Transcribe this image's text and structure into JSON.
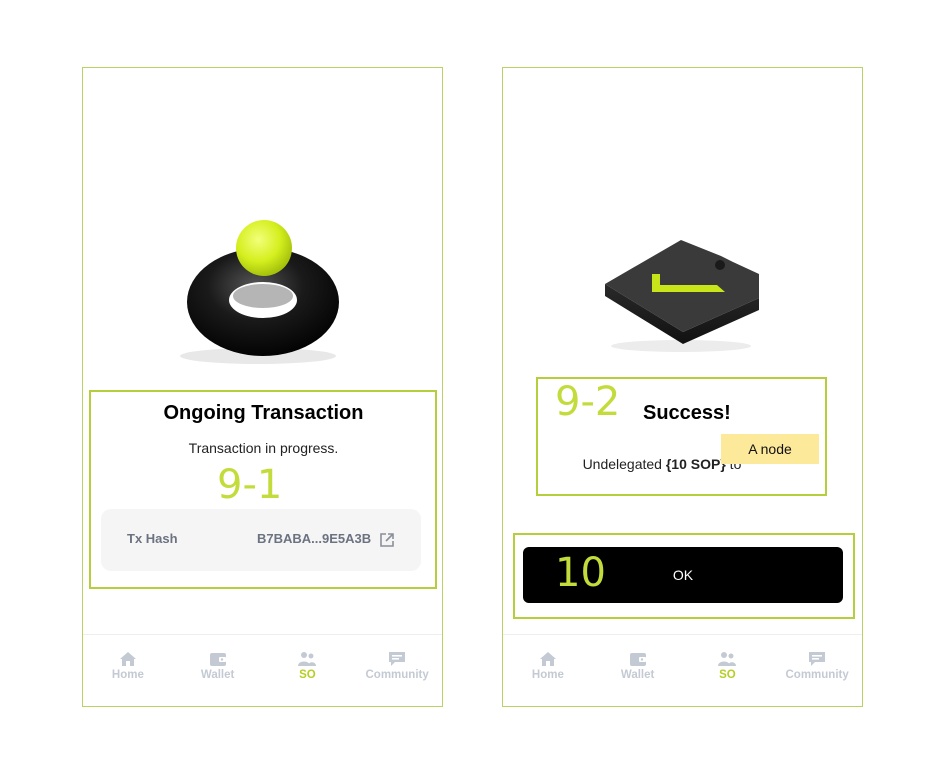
{
  "left_screen": {
    "step_label": "9-1",
    "title": "Ongoing Transaction",
    "subtitle": "Transaction in progress.",
    "tx_hash_label": "Tx Hash",
    "tx_hash_value": "B7BABA...9E5A3B"
  },
  "right_screen": {
    "step_label_success": "9-2",
    "title": "Success!",
    "message_prefix": "Undelegated ",
    "message_amount": "{10 SOP}",
    "message_suffix": " to",
    "node_name": "A node",
    "step_label_button": "10",
    "ok_label": "OK"
  },
  "tabbar": {
    "items": [
      {
        "label": "Home",
        "icon": "home-icon"
      },
      {
        "label": "Wallet",
        "icon": "wallet-icon"
      },
      {
        "label": "SO",
        "icon": "users-icon",
        "active": true
      },
      {
        "label": "Community",
        "icon": "chat-icon"
      }
    ]
  },
  "colors": {
    "accent": "#b5cf24",
    "highlight_border": "#b5cf3c",
    "chip": "#fde99a",
    "button": "#000000"
  }
}
